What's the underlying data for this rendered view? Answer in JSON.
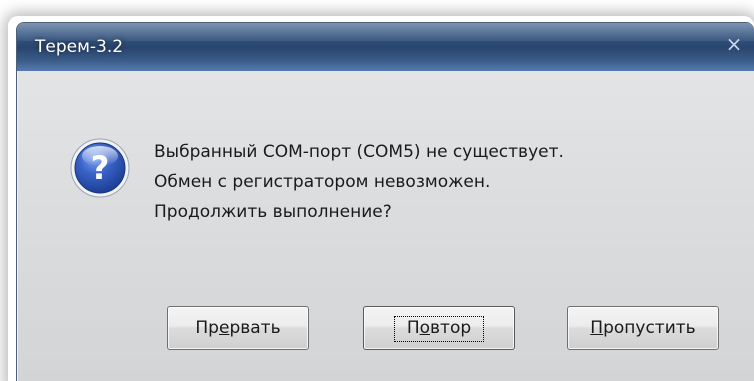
{
  "window": {
    "title": "Терем-3.2",
    "close_glyph": "×"
  },
  "dialog": {
    "icon": "question-icon",
    "message_lines": [
      "Выбранный COM-порт (COM5) не существует.",
      "Обмен с регистратором невозможен.",
      "Продолжить выполнение?"
    ],
    "buttons": {
      "abort": {
        "before": "Пр",
        "accel": "е",
        "after": "рвать"
      },
      "retry": {
        "before": "П",
        "accel": "о",
        "after": "втор"
      },
      "skip": {
        "before": "",
        "accel": "П",
        "after": "ропустить"
      }
    },
    "focused_button": "retry"
  },
  "colors": {
    "titlebar": "#2e4d78",
    "body": "#dcdddf",
    "icon_blue": "#2f56b8"
  }
}
